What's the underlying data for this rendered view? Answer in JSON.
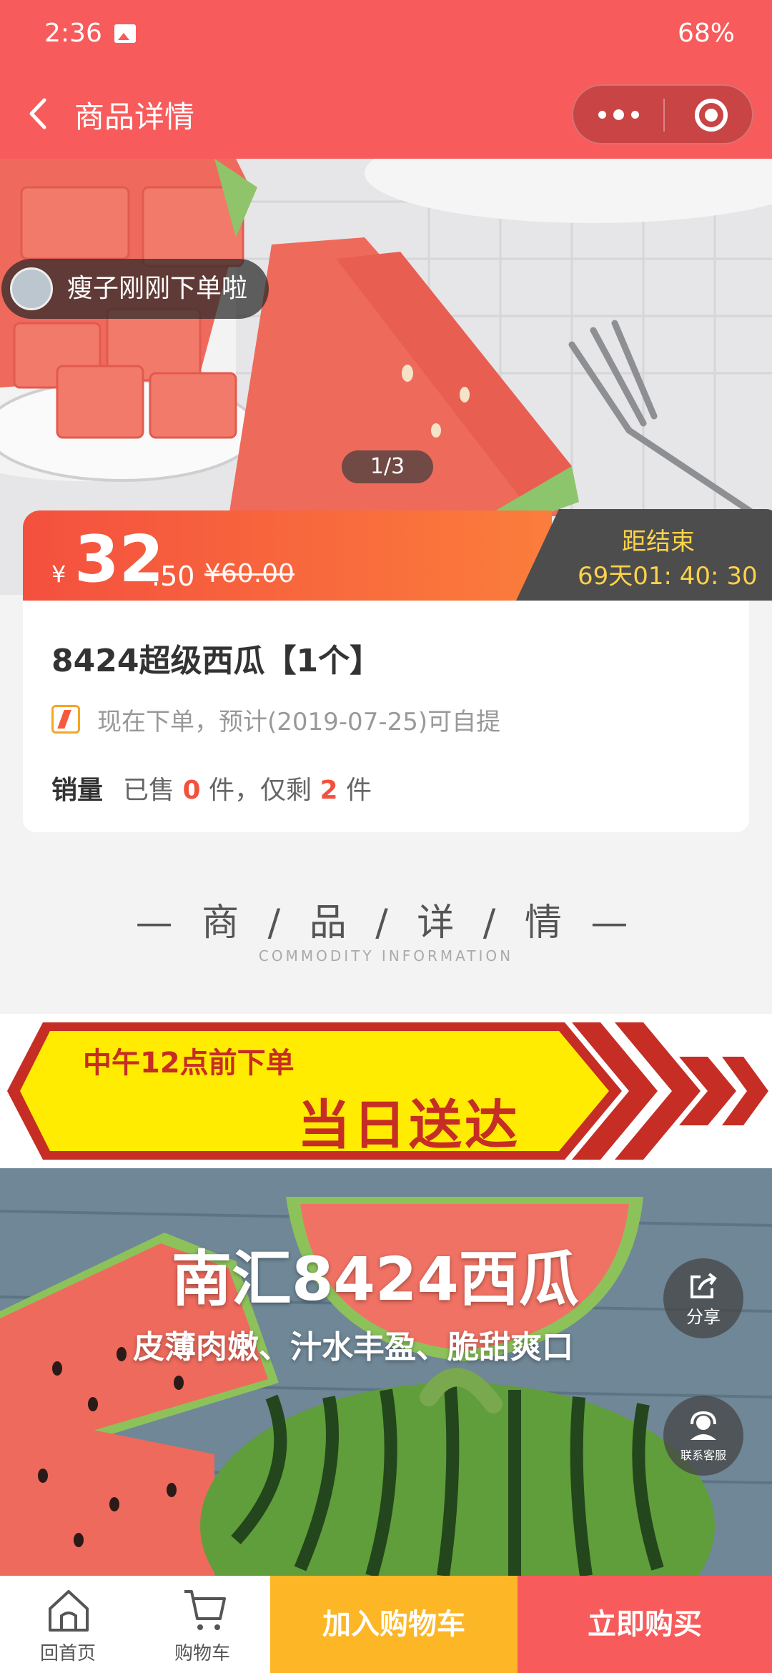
{
  "status_bar": {
    "time": "2:36",
    "battery": "68%"
  },
  "nav": {
    "title": "商品详情"
  },
  "hero": {
    "toast": "瘦子刚刚下单啦",
    "page_indicator": "1/3"
  },
  "price": {
    "currency": "¥",
    "integer": "32",
    "decimal": ".50",
    "original": "¥60.00"
  },
  "countdown": {
    "label": "距结束",
    "value": "69天01: 40: 30"
  },
  "product": {
    "title": "8424超级西瓜【1个】",
    "pickup_note": "现在下单，预计(2019-07-25)可自提",
    "sales_label": "销量",
    "sales_prefix": "已售",
    "sold_count": "0",
    "sales_mid": "件，仅剩",
    "remaining_count": "2",
    "sales_suffix": "件"
  },
  "section": {
    "title_cn": "— 商 / 品 / 详 / 情 —",
    "title_en": "COMMODITY INFORMATION"
  },
  "banner": {
    "line1": "中午12点前下单",
    "line2": "当日送达"
  },
  "detail_image": {
    "title": "南汇8424西瓜",
    "subtitle": "皮薄肉嫩、汁水丰盈、脆甜爽口"
  },
  "float_buttons": {
    "share": "分享",
    "service": "联系客服"
  },
  "bottom_bar": {
    "home": "回首页",
    "cart": "购物车",
    "add_to_cart": "加入购物车",
    "buy_now": "立即购买"
  },
  "colors": {
    "theme_red": "#f85b5b",
    "price_orange": "#fb7d3c",
    "countdown_gold": "#fbd24a",
    "cart_yellow": "#fcb626"
  }
}
